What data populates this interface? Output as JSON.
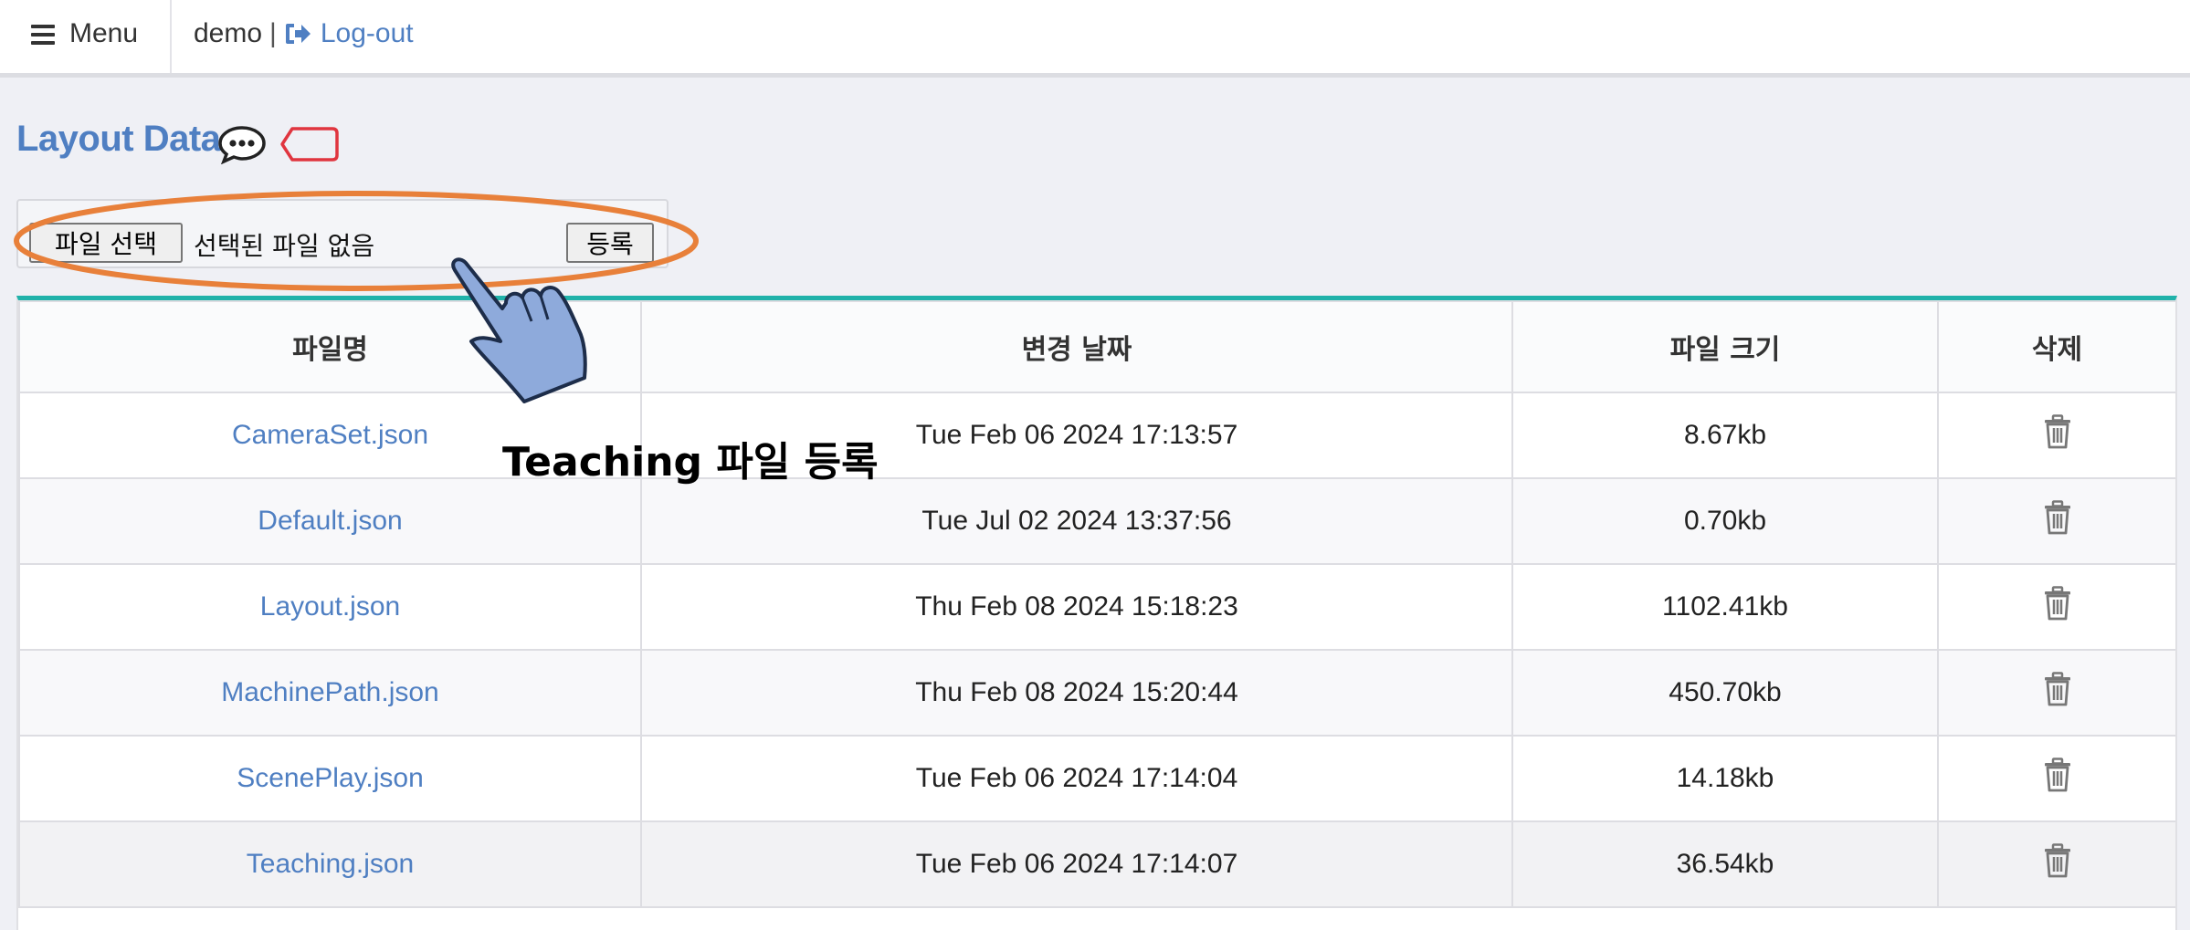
{
  "navbar": {
    "menu_label": "Menu",
    "user_name": "demo",
    "separator": "|",
    "logout_label": "Log-out"
  },
  "page": {
    "title": "Layout Data"
  },
  "upload": {
    "choose_label": "파일 선택",
    "no_file_text": "선택된 파일 없음",
    "register_label": "등록"
  },
  "table": {
    "headers": [
      "파일명",
      "변경 날짜",
      "파일 크기",
      "삭제"
    ],
    "rows": [
      {
        "name": "CameraSet.json",
        "date": "Tue Feb 06 2024 17:13:57",
        "size": "8.67kb"
      },
      {
        "name": "Default.json",
        "date": "Tue Jul 02 2024 13:37:56",
        "size": "0.70kb"
      },
      {
        "name": "Layout.json",
        "date": "Thu Feb 08 2024 15:18:23",
        "size": "1102.41kb"
      },
      {
        "name": "MachinePath.json",
        "date": "Thu Feb 08 2024 15:20:44",
        "size": "450.70kb"
      },
      {
        "name": "ScenePlay.json",
        "date": "Tue Feb 06 2024 17:14:04",
        "size": "14.18kb"
      },
      {
        "name": "Teaching.json",
        "date": "Tue Feb 06 2024 17:14:07",
        "size": "36.54kb"
      }
    ]
  },
  "annotation": {
    "caption": "Teaching 파일 등록"
  },
  "icons": {
    "menu": "hamburger-icon",
    "logout": "sign-out-icon",
    "comment": "comment-dots-icon",
    "tag": "tag-icon",
    "delete": "trash-icon",
    "pointer": "hand-pointer-icon"
  },
  "colors": {
    "link": "#4f7fc2",
    "accent_border": "#20b2aa",
    "highlight_ring": "#e8803a",
    "tag_red": "#e0353f",
    "hand_fill": "#8eaadb"
  }
}
